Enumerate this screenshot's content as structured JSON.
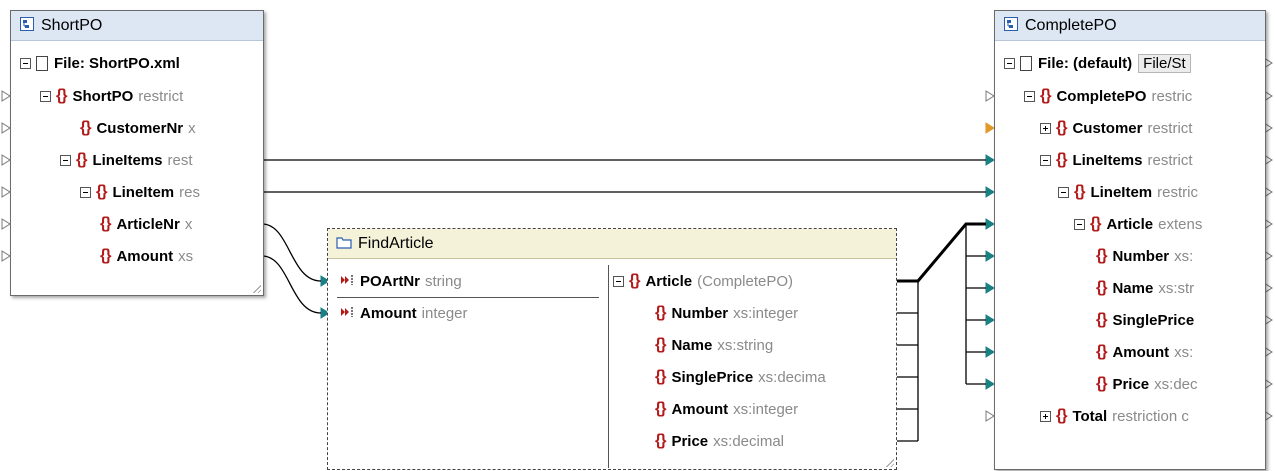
{
  "short_po": {
    "title": "ShortPO",
    "rows": [
      {
        "name": "File: ShortPO.xml",
        "type": ""
      },
      {
        "name": "ShortPO",
        "type": "restrict"
      },
      {
        "name": "CustomerNr",
        "type": "x"
      },
      {
        "name": "LineItems",
        "type": "rest"
      },
      {
        "name": "LineItem",
        "type": "res"
      },
      {
        "name": "ArticleNr",
        "type": "x"
      },
      {
        "name": "Amount",
        "type": "xs"
      }
    ]
  },
  "find_article": {
    "title": "FindArticle",
    "inputs": [
      {
        "name": "POArtNr",
        "type": "string"
      },
      {
        "name": "Amount",
        "type": "integer"
      }
    ],
    "outputs": [
      {
        "name": "Article",
        "type": "(CompletePO)"
      },
      {
        "name": "Number",
        "type": "xs:integer"
      },
      {
        "name": "Name",
        "type": "xs:string"
      },
      {
        "name": "SinglePrice",
        "type": "xs:decima"
      },
      {
        "name": "Amount",
        "type": "xs:integer"
      },
      {
        "name": "Price",
        "type": "xs:decimal"
      }
    ]
  },
  "complete_po": {
    "title": "CompletePO",
    "rows": [
      {
        "name": "File: (default)",
        "type": "",
        "extra": "File/St"
      },
      {
        "name": "CompletePO",
        "type": "restric"
      },
      {
        "name": "Customer",
        "type": "restrict"
      },
      {
        "name": "LineItems",
        "type": "restrict"
      },
      {
        "name": "LineItem",
        "type": "restric"
      },
      {
        "name": "Article",
        "type": "extens"
      },
      {
        "name": "Number",
        "type": "xs:"
      },
      {
        "name": "Name",
        "type": "xs:str"
      },
      {
        "name": "SinglePrice",
        "type": ""
      },
      {
        "name": "Amount",
        "type": "xs:"
      },
      {
        "name": "Price",
        "type": "xs:dec"
      },
      {
        "name": "Total",
        "type": "restriction c"
      }
    ]
  },
  "colors": {
    "connector": "#1b7f86",
    "wire": "#000000",
    "brace": "#b31b1b",
    "header_source": "#dde7f3",
    "header_function": "#f5f2da"
  },
  "icons": {
    "component": "xml-schema-icon",
    "function": "folder-icon",
    "node": "element-icon",
    "file": "file-icon",
    "input": "input-arrow-icon"
  }
}
